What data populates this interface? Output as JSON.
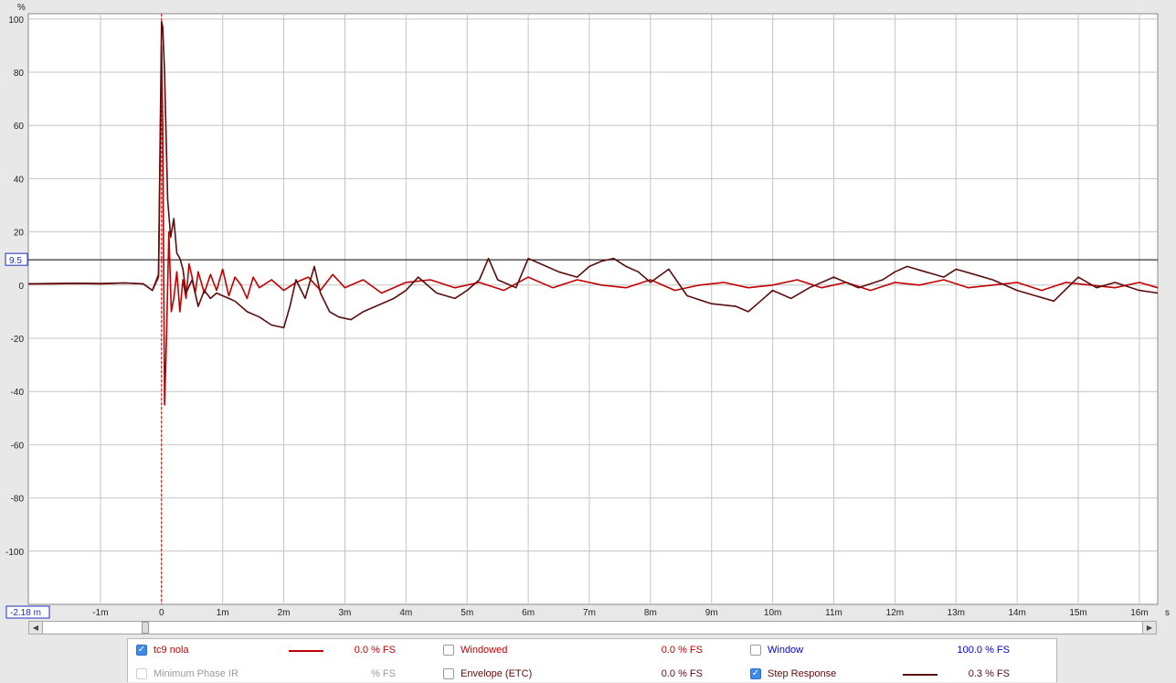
{
  "chart_data": {
    "type": "line",
    "ylabel": "%",
    "xunit": "s",
    "xlim": [
      -2.18,
      16.3
    ],
    "ylim": [
      -120,
      102
    ],
    "yticks": [
      100,
      80,
      60,
      40,
      20,
      0,
      -20,
      -40,
      -60,
      -80,
      -100
    ],
    "ytick_labels": [
      "100",
      "80",
      "60",
      "40",
      "20",
      "0",
      "-20",
      "-40",
      "-60",
      "-80",
      "-100"
    ],
    "xticks": [
      -1,
      0,
      1,
      2,
      3,
      4,
      5,
      6,
      7,
      8,
      9,
      10,
      11,
      12,
      13,
      14,
      15,
      16
    ],
    "xtick_labels": [
      "-1m",
      "0",
      "1m",
      "2m",
      "3m",
      "4m",
      "5m",
      "6m",
      "7m",
      "8m",
      "9m",
      "10m",
      "11m",
      "12m",
      "13m",
      "14m",
      "15m",
      "16m"
    ],
    "x_start_label": "-2.18 m",
    "y_cursor_value": 9.5,
    "y_cursor_label": "9.5",
    "x_marker": 0,
    "grid": true,
    "series": [
      {
        "name": "tc9 nola",
        "color": "#c00000",
        "x": [
          -2.18,
          -1.8,
          -1.4,
          -1.0,
          -0.6,
          -0.3,
          -0.15,
          -0.05,
          0,
          0.02,
          0.05,
          0.08,
          0.12,
          0.16,
          0.2,
          0.25,
          0.3,
          0.35,
          0.4,
          0.45,
          0.5,
          0.55,
          0.6,
          0.7,
          0.8,
          0.9,
          1.0,
          1.1,
          1.2,
          1.3,
          1.4,
          1.5,
          1.6,
          1.8,
          2.0,
          2.2,
          2.4,
          2.6,
          2.8,
          3.0,
          3.3,
          3.6,
          4.0,
          4.4,
          4.8,
          5.2,
          5.6,
          6.0,
          6.4,
          6.8,
          7.2,
          7.6,
          8.0,
          8.4,
          8.8,
          9.2,
          9.6,
          10.0,
          10.4,
          10.8,
          11.2,
          11.6,
          12.0,
          12.4,
          12.8,
          13.2,
          13.6,
          14.0,
          14.4,
          14.8,
          15.2,
          15.6,
          16.0,
          16.3
        ],
        "y": [
          0.5,
          0.5,
          0.7,
          0.5,
          0.8,
          0.5,
          -2,
          3,
          90,
          60,
          -45,
          -20,
          20,
          -10,
          -5,
          5,
          -10,
          2,
          -5,
          8,
          3,
          -3,
          5,
          -3,
          4,
          -2,
          6,
          -4,
          3,
          0,
          -5,
          3,
          -1,
          2,
          -2,
          1,
          3,
          -2,
          4,
          -1,
          2,
          -3,
          1,
          2,
          -1,
          1,
          -2,
          3,
          -1,
          2,
          0,
          -1,
          2,
          -2,
          0,
          1,
          -1,
          0,
          2,
          -1,
          1,
          -2,
          1,
          0,
          2,
          -1,
          0,
          1,
          -2,
          1,
          0,
          -1,
          1,
          -1
        ]
      },
      {
        "name": "Step Response",
        "color": "#5a0d0d",
        "x": [
          -2.18,
          -1.8,
          -1.4,
          -1.0,
          -0.6,
          -0.3,
          -0.15,
          -0.05,
          0,
          0.02,
          0.05,
          0.1,
          0.15,
          0.2,
          0.25,
          0.3,
          0.35,
          0.4,
          0.5,
          0.6,
          0.7,
          0.8,
          0.9,
          1.0,
          1.2,
          1.4,
          1.6,
          1.8,
          2.0,
          2.1,
          2.2,
          2.35,
          2.5,
          2.6,
          2.75,
          2.9,
          3.1,
          3.3,
          3.5,
          3.8,
          4.0,
          4.2,
          4.5,
          4.8,
          5.0,
          5.2,
          5.35,
          5.5,
          5.8,
          6.0,
          6.2,
          6.5,
          6.8,
          7.0,
          7.2,
          7.4,
          7.6,
          7.8,
          8.0,
          8.3,
          8.6,
          9.0,
          9.4,
          9.6,
          9.8,
          10.0,
          10.3,
          10.6,
          11.0,
          11.4,
          11.8,
          12.0,
          12.2,
          12.5,
          12.8,
          13.0,
          13.3,
          13.6,
          14.0,
          14.3,
          14.6,
          15.0,
          15.3,
          15.6,
          16.0,
          16.3
        ],
        "y": [
          0.5,
          0.6,
          0.7,
          0.6,
          0.8,
          0.5,
          -2,
          4,
          99,
          97,
          80,
          32,
          18,
          25,
          12,
          10,
          6,
          -3,
          2,
          -8,
          -2,
          -5,
          -3,
          -4,
          -6,
          -10,
          -12,
          -15,
          -16,
          -8,
          2,
          -5,
          7,
          -3,
          -10,
          -12,
          -13,
          -10,
          -8,
          -5,
          -2,
          3,
          -3,
          -5,
          -2,
          2,
          10,
          2,
          -1,
          10,
          8,
          5,
          3,
          7,
          9,
          10,
          7,
          5,
          1,
          6,
          -4,
          -7,
          -8,
          -10,
          -6,
          -2,
          -5,
          -1,
          3,
          -1,
          2,
          5,
          7,
          5,
          3,
          6,
          4,
          2,
          -2,
          -4,
          -6,
          3,
          -1,
          1,
          -2,
          -3
        ]
      }
    ]
  },
  "legend": {
    "row1": [
      {
        "label": "tc9 nola",
        "value": "0.0 % FS",
        "checked": true,
        "color": "#c00000"
      },
      {
        "label": "Windowed",
        "value": "0.0 % FS",
        "checked": false,
        "color": "#c00000"
      },
      {
        "label": "Window",
        "value": "100.0 % FS",
        "checked": false,
        "color": "#0000cc"
      }
    ],
    "row2": [
      {
        "label": "Minimum Phase IR",
        "value": "% FS",
        "checked": false,
        "color": "#a0a0a0"
      },
      {
        "label": "Envelope (ETC)",
        "value": "0.0 % FS",
        "checked": false,
        "color": "#5a0d0d"
      },
      {
        "label": "Step Response",
        "value": "0.3 % FS",
        "checked": true,
        "color": "#5a0d0d"
      }
    ]
  }
}
